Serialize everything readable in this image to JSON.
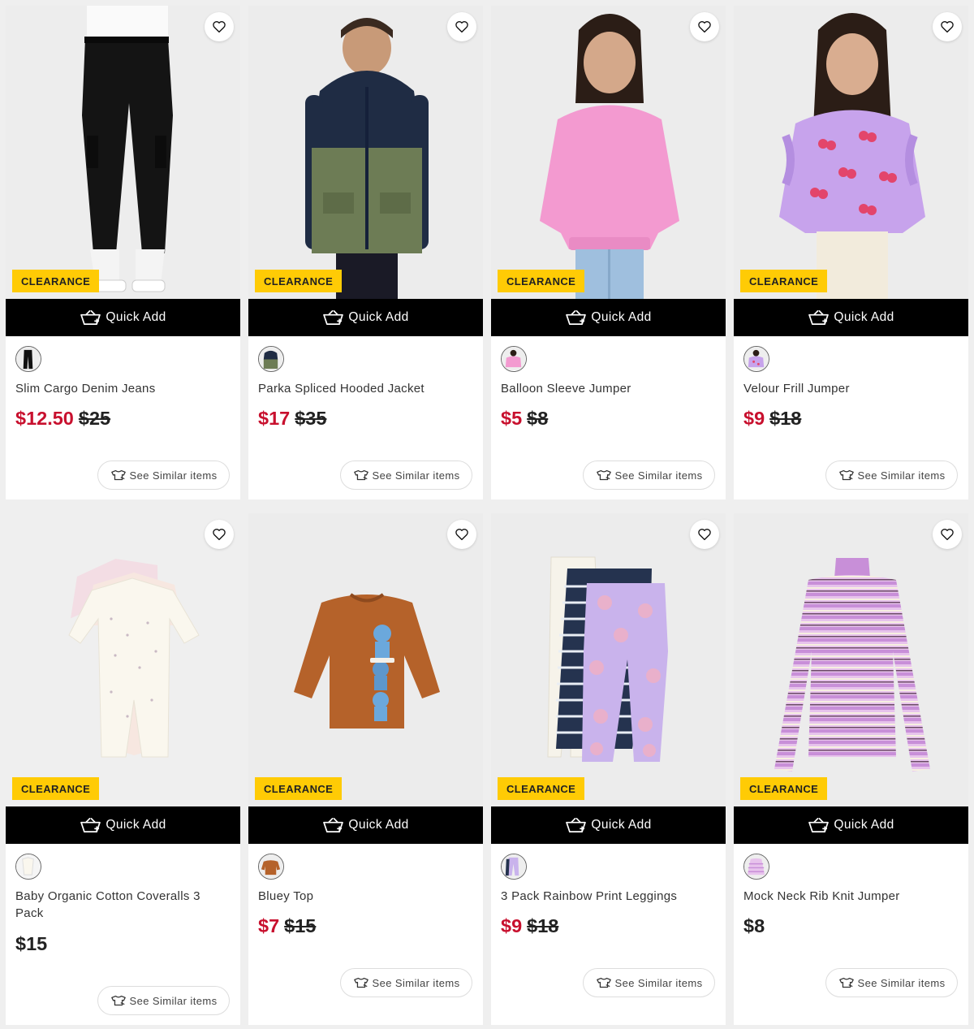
{
  "common": {
    "badge": "CLEARANCE",
    "quick_add": "Quick Add",
    "see_similar": "See Similar items"
  },
  "colors": {
    "sale_price": "#c8102e",
    "badge_bg": "#ffcb05",
    "quick_add_bg": "#000000"
  },
  "products": [
    {
      "name": "Slim Cargo Denim Jeans",
      "price": "$12.50",
      "was": "$25",
      "image": "black-cargo-jeans"
    },
    {
      "name": "Parka Spliced Hooded Jacket",
      "price": "$17",
      "was": "$35",
      "image": "navy-khaki-parka"
    },
    {
      "name": "Balloon Sleeve Jumper",
      "price": "$5",
      "was": "$8",
      "image": "pink-jumper"
    },
    {
      "name": "Velour Frill Jumper",
      "price": "$9",
      "was": "$18",
      "image": "lilac-cherry-jumper"
    },
    {
      "name": "Baby Organic Cotton Coveralls 3 Pack",
      "price": "$15",
      "was": "",
      "image": "coveralls-3-pack"
    },
    {
      "name": "Bluey Top",
      "price": "$7",
      "was": "$15",
      "image": "bluey-tan-top"
    },
    {
      "name": "3 Pack Rainbow Print Leggings",
      "price": "$9",
      "was": "$18",
      "image": "leggings-3-pack"
    },
    {
      "name": "Mock Neck Rib Knit Jumper",
      "price": "$8",
      "was": "",
      "image": "striped-rib-jumper"
    }
  ]
}
